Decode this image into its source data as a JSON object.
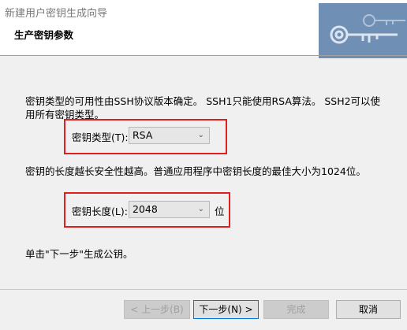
{
  "window": {
    "title": "新建用户密钥生成向导",
    "help_icon": "?",
    "close_icon": "✕"
  },
  "header": {
    "title": "生产密钥参数",
    "graphic_icon": "key-icon"
  },
  "content": {
    "desc_type": "密钥类型的可用性由SSH协议版本确定。 SSH1只能使用RSA算法。 SSH2可以使用所有密钥类型。",
    "desc_length": "密钥的长度越长安全性越高。普通应用程序中密钥长度的最佳大小为1024位。",
    "desc_next": "单击\"下一步\"生成公钥。"
  },
  "form": {
    "key_type_label": "密钥类型(T):",
    "key_type_value": "RSA",
    "key_length_label": "密钥长度(L):",
    "key_length_value": "2048",
    "key_length_unit": "位"
  },
  "buttons": {
    "back": "< 上一步(B)",
    "next": "下一步(N) >",
    "finish": "完成",
    "cancel": "取消"
  },
  "colors": {
    "highlight": "#e02020",
    "key_graphic_bg": "#6f8fb5",
    "focus_border": "#0078d7"
  }
}
